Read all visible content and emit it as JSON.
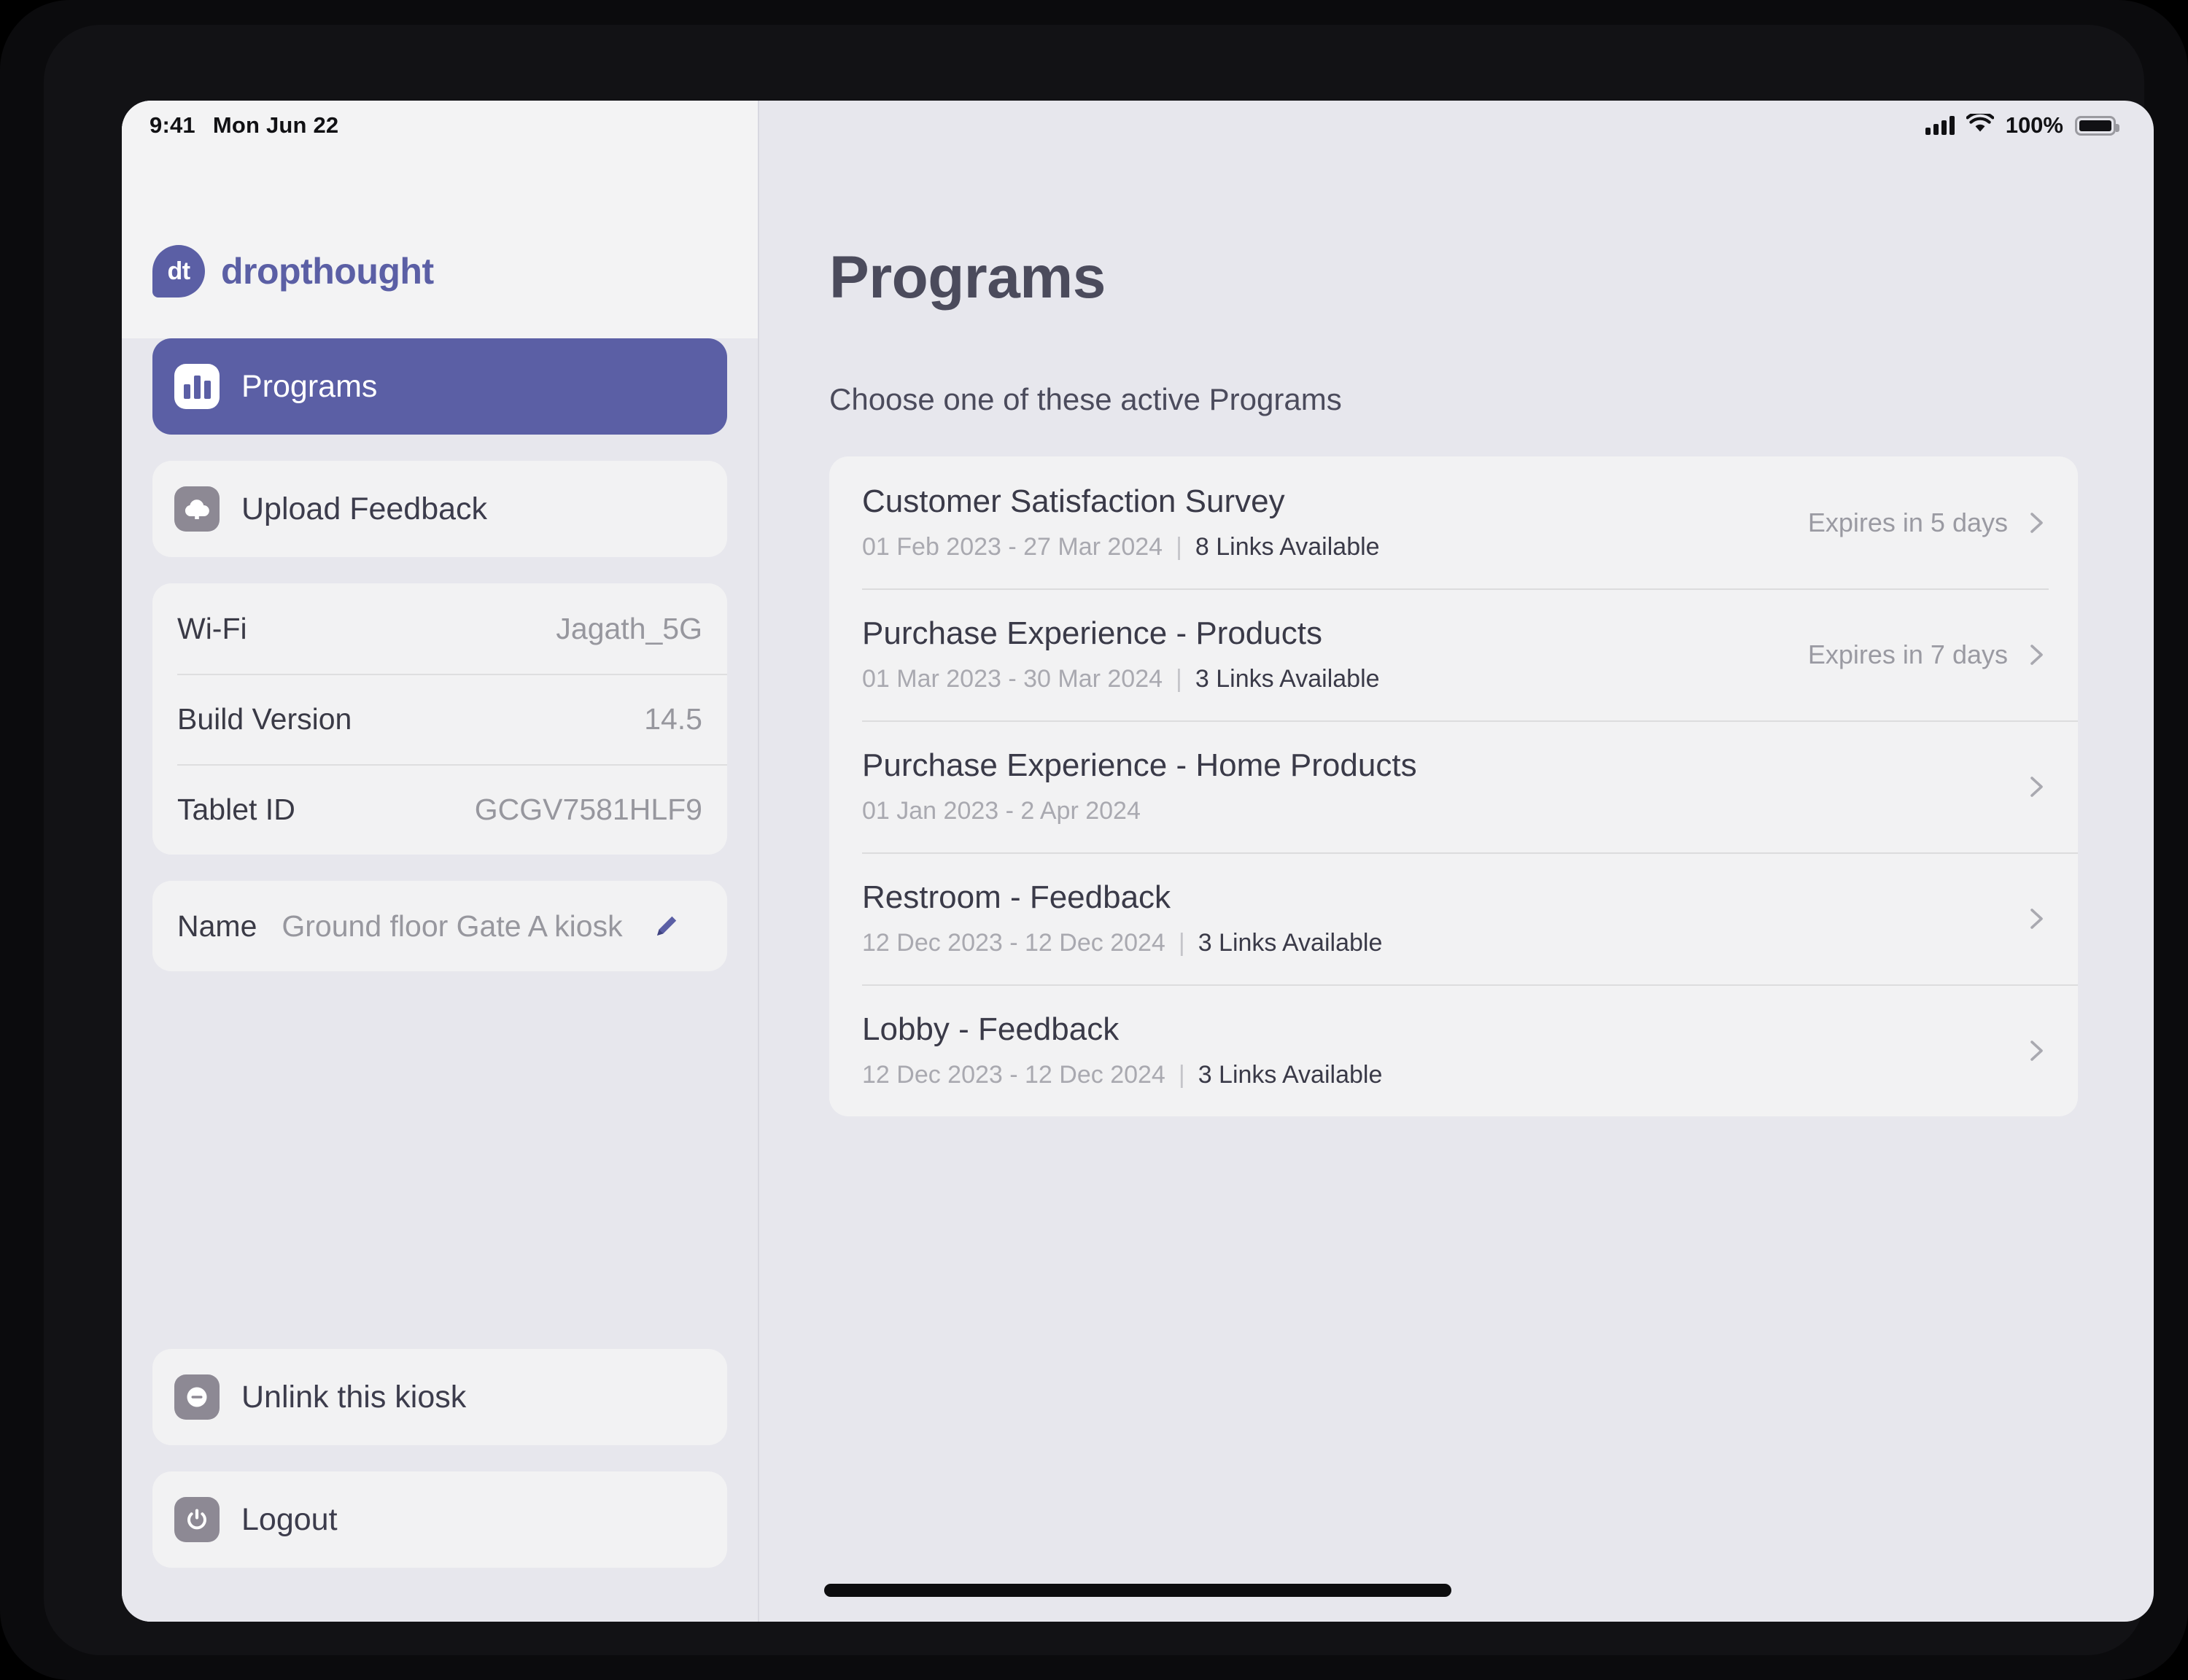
{
  "statusbar": {
    "time": "9:41",
    "date": "Mon Jun 22",
    "battery_percent": "100%",
    "signal_icon": "cellular-signal-icon",
    "wifi_icon": "wifi-icon",
    "battery_icon": "battery-full-icon"
  },
  "sidebar": {
    "brand": {
      "mark": "dt",
      "name": "dropthought"
    },
    "nav": [
      {
        "label": "Programs",
        "icon": "bar-chart-icon",
        "active": true
      },
      {
        "label": "Upload Feedback",
        "icon": "cloud-upload-icon",
        "active": false
      }
    ],
    "info": [
      {
        "key": "Wi-Fi",
        "value": "Jagath_5G"
      },
      {
        "key": "Build Version",
        "value": "14.5"
      },
      {
        "key": "Tablet ID",
        "value": "GCGV7581HLF9"
      }
    ],
    "name_row": {
      "key": "Name",
      "value": "Ground floor Gate A kiosk",
      "edit_icon": "pencil-edit-icon"
    },
    "actions": [
      {
        "label": "Unlink this kiosk",
        "icon": "minus-circle-icon"
      },
      {
        "label": "Logout",
        "icon": "power-icon"
      }
    ]
  },
  "main": {
    "title": "Programs",
    "subtitle": "Choose one of these active Programs",
    "programs": [
      {
        "title": "Customer Satisfaction Survey",
        "date_range": "01 Feb 2023 - 27 Mar 2024",
        "links": "8 Links Available",
        "expiry": "Expires in 5 days",
        "chevron": "chevron-right-icon"
      },
      {
        "title": "Purchase Experience - Products",
        "date_range": "01 Mar 2023 - 30 Mar 2024",
        "links": "3 Links Available",
        "expiry": "Expires in 7 days",
        "chevron": "chevron-right-icon"
      },
      {
        "title": "Purchase Experience - Home Products",
        "date_range": "01 Jan 2023 - 2 Apr 2024",
        "links": "",
        "expiry": "",
        "chevron": "chevron-right-icon"
      },
      {
        "title": "Restroom - Feedback",
        "date_range": "12 Dec 2023 - 12 Dec 2024",
        "links": "3 Links Available",
        "expiry": "",
        "chevron": "chevron-right-icon"
      },
      {
        "title": "Lobby - Feedback",
        "date_range": "12 Dec 2023 - 12 Dec 2024",
        "links": "3 Links Available",
        "expiry": "",
        "chevron": "chevron-right-icon"
      }
    ]
  },
  "colors": {
    "accent": "#5b5fa5",
    "screen_bg": "#e7e7ed",
    "card_bg": "#f2f2f3",
    "text_dark": "#3a3a48",
    "text_muted": "#a9a9b0"
  }
}
